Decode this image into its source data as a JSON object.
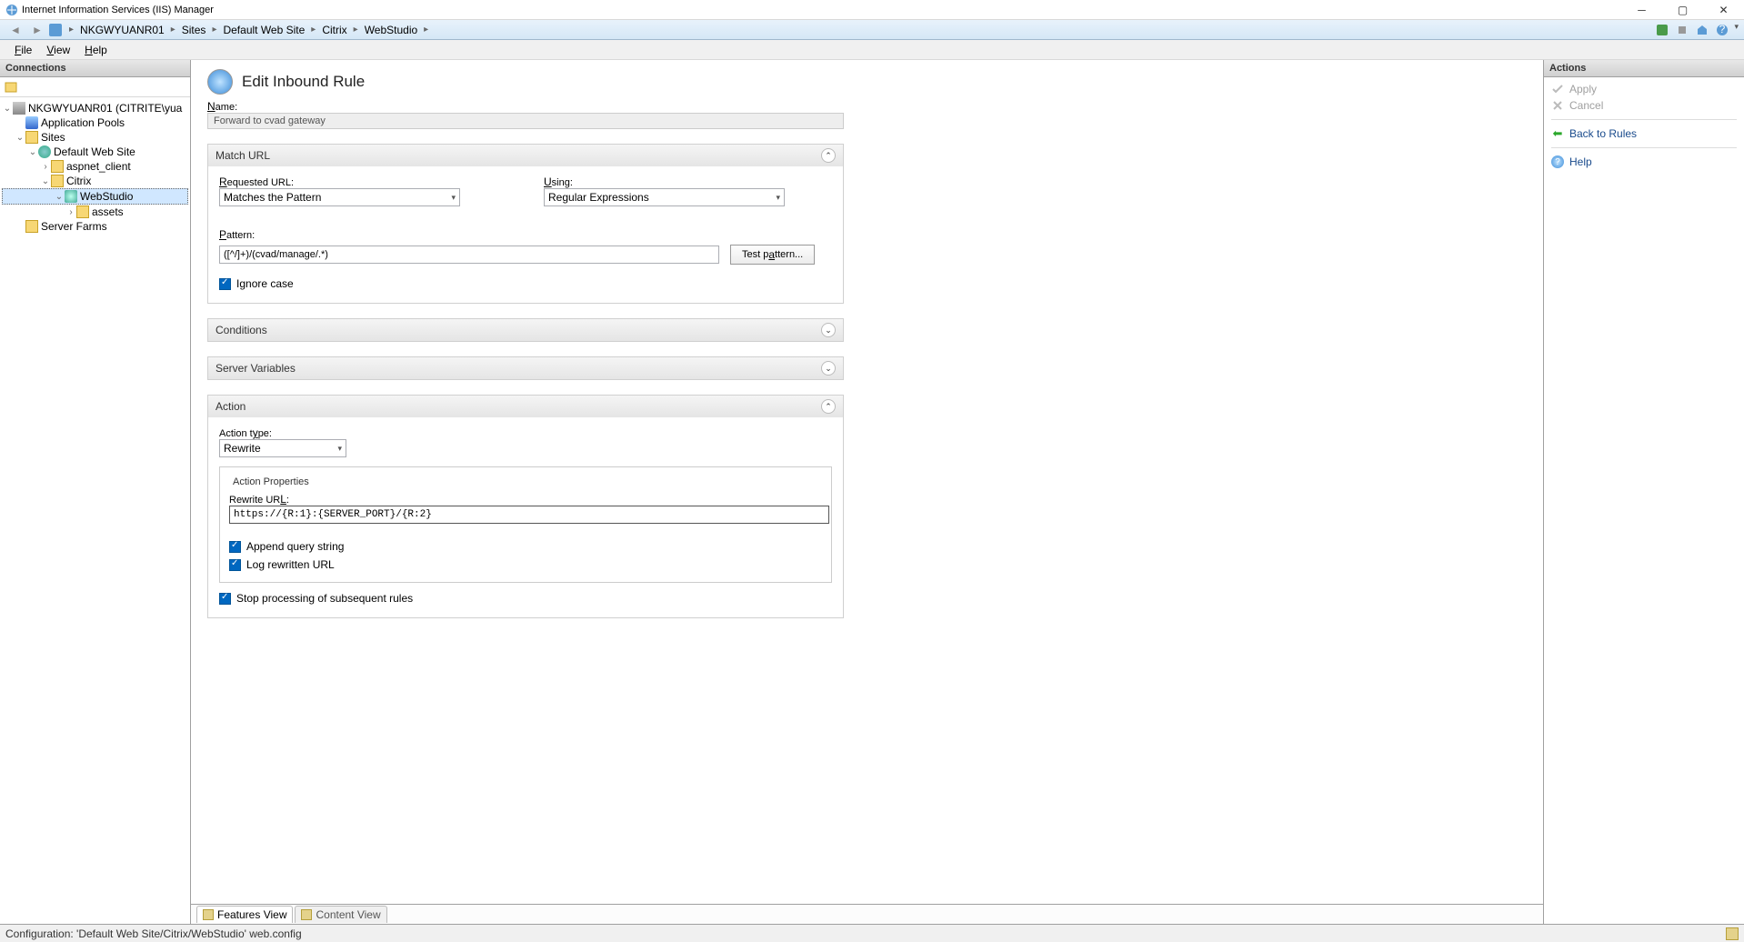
{
  "window": {
    "title": "Internet Information Services (IIS) Manager"
  },
  "breadcrumb": [
    "NKGWYUANR01",
    "Sites",
    "Default Web Site",
    "Citrix",
    "WebStudio"
  ],
  "menu": {
    "file": "File",
    "view": "View",
    "help": "Help"
  },
  "connections": {
    "header": "Connections",
    "root": "NKGWYUANR01 (CITRITE\\yua",
    "app_pools": "Application Pools",
    "sites": "Sites",
    "default_site": "Default Web Site",
    "aspnet_client": "aspnet_client",
    "citrix": "Citrix",
    "webstudio": "WebStudio",
    "assets": "assets",
    "server_farms": "Server Farms"
  },
  "page": {
    "title": "Edit Inbound Rule",
    "name_label": "Name:",
    "name_value": "Forward to cvad gateway",
    "match_url": {
      "header": "Match URL",
      "requested_label": "Requested URL:",
      "requested_value": "Matches the Pattern",
      "using_label": "Using:",
      "using_value": "Regular Expressions",
      "pattern_label": "Pattern:",
      "pattern_value": "([^/]+)/(cvad/manage/.*)",
      "test_pattern": "Test pattern...",
      "ignore_case": "Ignore case"
    },
    "conditions": {
      "header": "Conditions"
    },
    "server_vars": {
      "header": "Server Variables"
    },
    "action": {
      "header": "Action",
      "type_label": "Action type:",
      "type_value": "Rewrite",
      "props_label": "Action Properties",
      "rewrite_label": "Rewrite URL:",
      "rewrite_value": "https://{R:1}:{SERVER_PORT}/{R:2}",
      "append_query": "Append query string",
      "log_rewritten": "Log rewritten URL",
      "stop_processing": "Stop processing of subsequent rules"
    }
  },
  "tabs": {
    "features": "Features View",
    "content": "Content View"
  },
  "actions": {
    "header": "Actions",
    "apply": "Apply",
    "cancel": "Cancel",
    "back": "Back to Rules",
    "help": "Help"
  },
  "statusbar": {
    "text": "Configuration: 'Default Web Site/Citrix/WebStudio' web.config"
  }
}
